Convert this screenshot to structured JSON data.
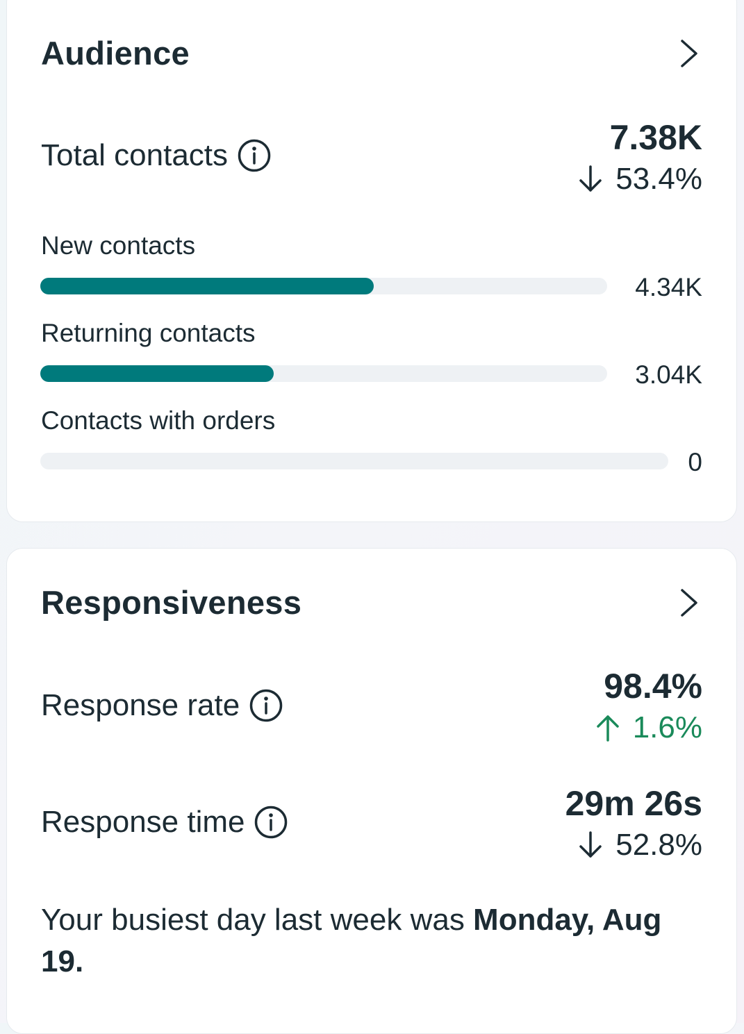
{
  "audience": {
    "title": "Audience",
    "total_contacts": {
      "label": "Total contacts",
      "value": "7.38K",
      "change": "53.4%",
      "direction": "down"
    },
    "bars": [
      {
        "label": "New contacts",
        "value": "4.34K",
        "fraction": 0.588
      },
      {
        "label": "Returning contacts",
        "value": "3.04K",
        "fraction": 0.412
      },
      {
        "label": "Contacts with orders",
        "value": "0",
        "fraction": 0
      }
    ],
    "bar_color": "#007a7c"
  },
  "responsiveness": {
    "title": "Responsiveness",
    "response_rate": {
      "label": "Response rate",
      "value": "98.4%",
      "change": "1.6%",
      "direction": "up",
      "change_color": "#1a8a5a"
    },
    "response_time": {
      "label": "Response time",
      "value": "29m 26s",
      "change": "52.8%",
      "direction": "down"
    },
    "busiest_prefix": "Your busiest day last week was ",
    "busiest_day": "Monday, Aug 19."
  },
  "icons": {
    "chevron": "chevron-right-icon",
    "info": "info-icon",
    "down": "arrow-down-icon",
    "up": "arrow-up-icon"
  }
}
